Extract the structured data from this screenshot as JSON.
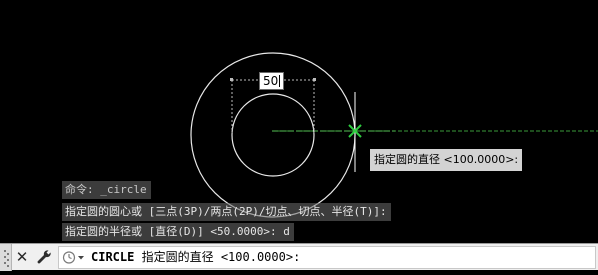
{
  "viewport": {
    "dimension_input": "50",
    "dynamic_prompt": "指定圆的直径 <100.0000>:"
  },
  "command_history": [
    "命令: _circle",
    "指定圆的圆心或 [三点(3P)/两点(2P)/切点、切点、半径(T)]:",
    "指定圆的半径或 [直径(D)] <50.0000>: d"
  ],
  "command_line": {
    "command": "CIRCLE",
    "prompt": "指定圆的直径 <100.0000>:",
    "icons": [
      "grip-icon",
      "close-icon",
      "wrench-icon",
      "recent-commands-icon"
    ]
  },
  "colors": {
    "background": "#000000",
    "geometry": "#ffffff",
    "snap_marker": "#2ecc40",
    "tracking_line": "#3a9a3a",
    "history_bg": "#6e6e6e",
    "tooltip_bg": "#d3d3d3"
  }
}
